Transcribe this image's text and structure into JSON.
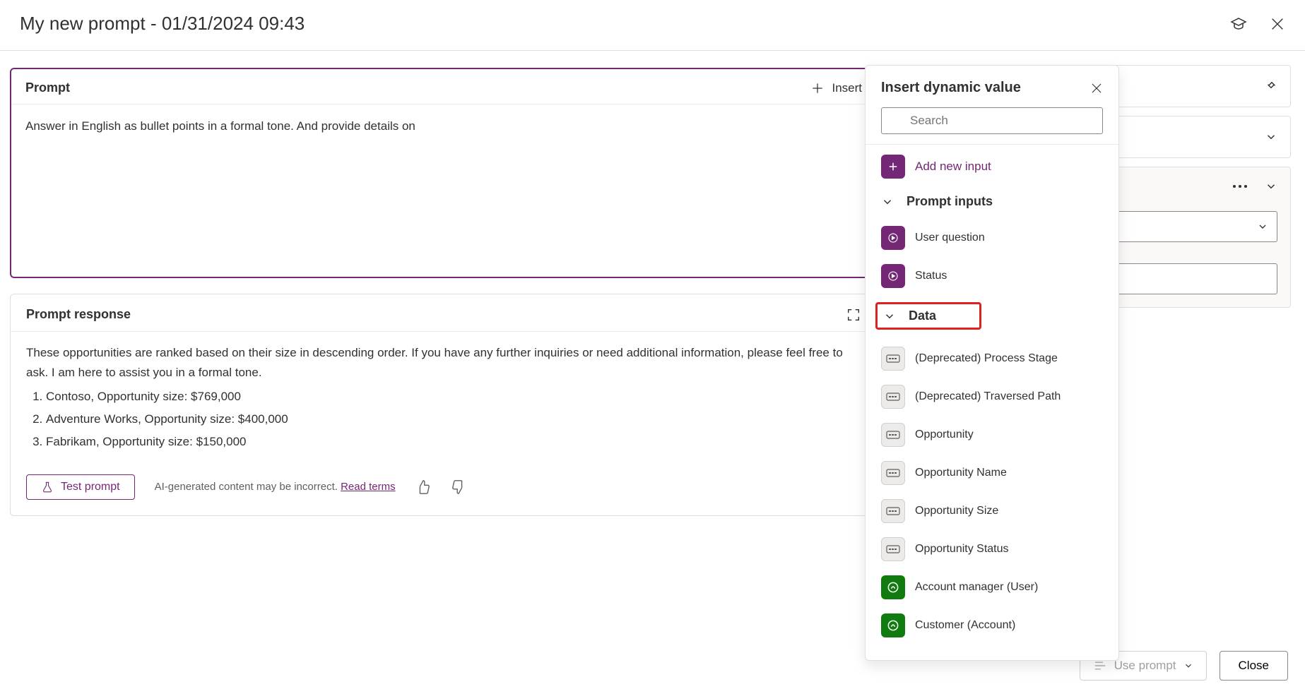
{
  "header": {
    "title": "My new prompt - 01/31/2024 09:43"
  },
  "prompt": {
    "section_label": "Prompt",
    "insert_label": "Insert",
    "body_text": "Answer in English as bullet points in a formal tone. And provide details on"
  },
  "response": {
    "section_label": "Prompt response",
    "intro": "These opportunities are ranked based on their size in descending order. If you have any further inquiries or need additional information, please feel free to ask. I am here to assist you in a formal tone.",
    "items": [
      "Contoso, Opportunity size: $769,000",
      "Adventure Works, Opportunity size: $400,000",
      "Fabrikam, Opportunity size: $150,000"
    ],
    "test_label": "Test prompt",
    "disclaimer": "AI-generated content may be incorrect.",
    "read_terms": "Read terms"
  },
  "dynamic_panel": {
    "title": "Insert dynamic value",
    "search_placeholder": "Search",
    "add_input_label": "Add new input",
    "sections": {
      "prompt_inputs": {
        "label": "Prompt inputs",
        "items": [
          {
            "label": "User question",
            "badge": "purple"
          },
          {
            "label": "Status",
            "badge": "purple"
          }
        ]
      },
      "data": {
        "label": "Data",
        "items": [
          {
            "label": "(Deprecated) Process Stage",
            "badge": "gray"
          },
          {
            "label": "(Deprecated) Traversed Path",
            "badge": "gray"
          },
          {
            "label": "Opportunity",
            "badge": "gray"
          },
          {
            "label": "Opportunity Name",
            "badge": "gray"
          },
          {
            "label": "Opportunity Size",
            "badge": "gray"
          },
          {
            "label": "Opportunity Status",
            "badge": "gray"
          },
          {
            "label": "Account manager (User)",
            "badge": "green"
          },
          {
            "label": "Customer (Account)",
            "badge": "green"
          }
        ]
      }
    }
  },
  "bottom": {
    "use_prompt": "Use prompt",
    "close": "Close"
  }
}
